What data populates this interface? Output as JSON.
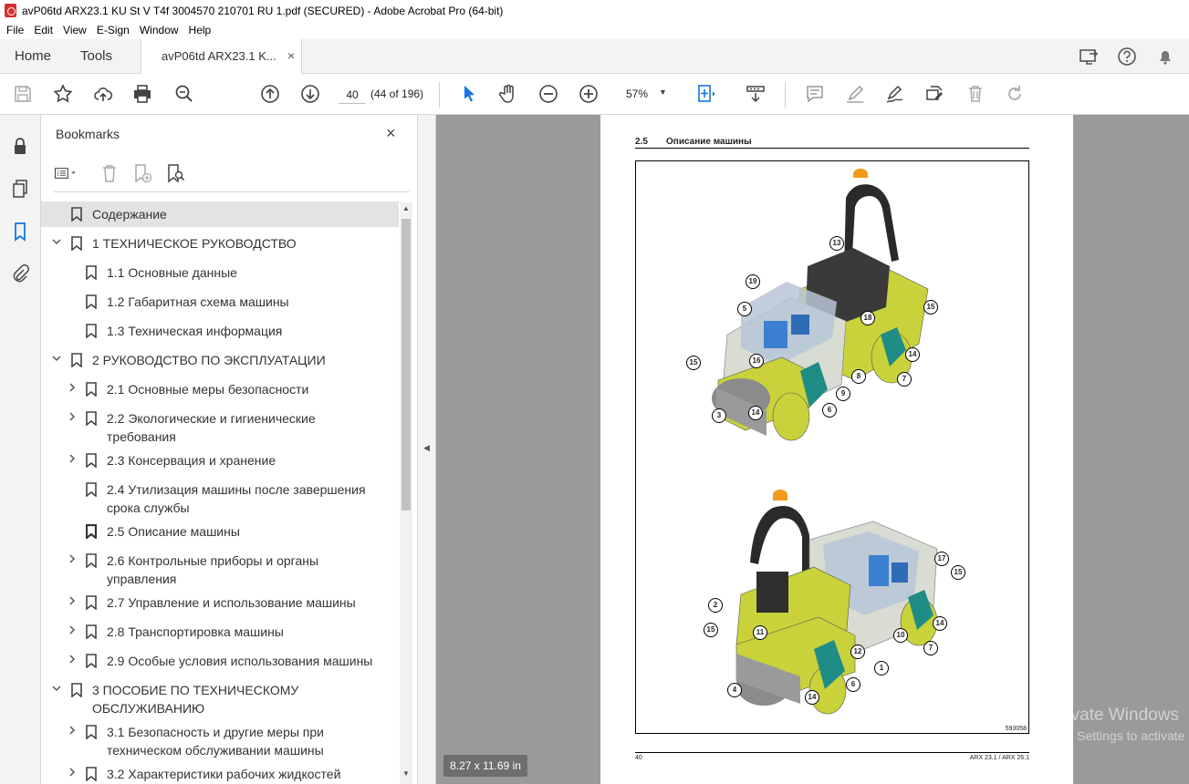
{
  "window": {
    "title": "avP06td ARX23.1 KU St V T4f 3004570 210701 RU 1.pdf (SECURED) - Adobe Acrobat Pro (64-bit)"
  },
  "menu": [
    "File",
    "Edit",
    "View",
    "E-Sign",
    "Window",
    "Help"
  ],
  "tabs": {
    "home": "Home",
    "tools": "Tools",
    "document": "avP06td ARX23.1 K...",
    "close": "×"
  },
  "toolbar": {
    "page_value": "40",
    "page_count": "(44 of 196)",
    "zoom": "57%",
    "zoom_caret": "▼"
  },
  "bookmarks": {
    "title": "Bookmarks",
    "close": "×",
    "items": [
      {
        "label": "Содержание",
        "selected": true
      },
      {
        "label": "1 ТЕХНИЧЕСКОЕ РУКОВОДСТВО",
        "expanded": true
      },
      {
        "label": "1.1 Основные данные"
      },
      {
        "label": "1.2 Габаритная схема машины"
      },
      {
        "label": "1.3 Техническая информация"
      },
      {
        "label": "2 РУКОВОДСТВО ПО ЭКСПЛУАТАЦИИ",
        "expanded": true
      },
      {
        "label": "2.1 Основные меры безопасности"
      },
      {
        "label": "2.2 Экологические и гигиенические",
        "label2": "требования"
      },
      {
        "label": "2.3 Консервация и хранение"
      },
      {
        "label": "2.4 Утилизация машины после завершения",
        "label2": "срока службы"
      },
      {
        "label": "2.5 Описание машины",
        "current": true
      },
      {
        "label": "2.6 Контрольные приборы и органы",
        "label2": "управления"
      },
      {
        "label": "2.7 Управление и использование машины"
      },
      {
        "label": "2.8 Транспортировка машины"
      },
      {
        "label": "2.9 Особые условия использования машины"
      },
      {
        "label": "3 ПОСОБИЕ ПО ТЕХНИЧЕСКОМУ",
        "label2": "ОБСЛУЖИВАНИЮ",
        "expanded": true
      },
      {
        "label": "3.1 Безопасность и другие меры при",
        "label2": "техническом обслуживании машины"
      },
      {
        "label": "3.2 Характеристики рабочих жидкостей"
      }
    ]
  },
  "document": {
    "section_number": "2.5",
    "section_title": "Описание машины",
    "figure_code": "593058",
    "footer_left": "40",
    "footer_right": "ARX 23.1 / ARX 26.1",
    "callouts_top": [
      "13",
      "19",
      "5",
      "18",
      "15",
      "14",
      "15",
      "16",
      "8",
      "7",
      "9",
      "3",
      "14",
      "6"
    ],
    "callouts_bottom": [
      "17",
      "15",
      "2",
      "15",
      "11",
      "14",
      "10",
      "12",
      "7",
      "1",
      "6",
      "4",
      "14"
    ]
  },
  "status": {
    "page_size": "8.27 x 11.69 in"
  },
  "watermark": {
    "line1": "Activate Windows",
    "line2": "Go to Settings to activate"
  },
  "colors": {
    "machine_body": "#c9d23a",
    "accent_blue": "#1473e6"
  }
}
